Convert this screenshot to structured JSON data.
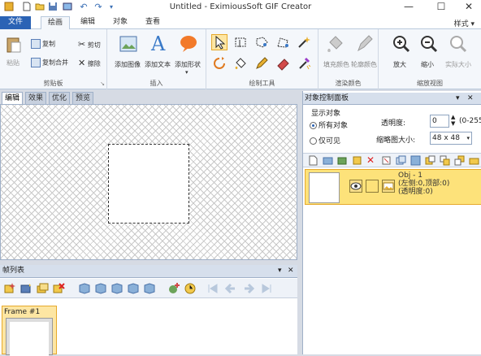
{
  "window": {
    "title": "Untitled - EximiousSoft GIF Creator",
    "style_menu": "样式 ▾"
  },
  "tabs": [
    {
      "label": "文件"
    },
    {
      "label": "绘画"
    },
    {
      "label": "编辑"
    },
    {
      "label": "对象"
    },
    {
      "label": "查看"
    }
  ],
  "ribbon": {
    "clipboard": {
      "name": "剪贴板",
      "paste": "粘贴",
      "copy": "复制",
      "cut": "剪切",
      "copy_merge": "复制合并",
      "erase": "擦除"
    },
    "insert": {
      "name": "插入",
      "add_image": "添加图像",
      "add_text": "添加文本",
      "add_shape": "添加形状"
    },
    "draw_tools": {
      "name": "绘制工具"
    },
    "fill_color": {
      "name": "渲染颜色",
      "fill": "填充颜色",
      "outline": "轮廓颜色"
    },
    "zoom": {
      "name": "缩放视图",
      "zoom_in": "放大",
      "zoom_out": "缩小",
      "actual_size": "实际大小"
    }
  },
  "doc_tabs": [
    {
      "label": "编辑"
    },
    {
      "label": "效果"
    },
    {
      "label": "优化"
    },
    {
      "label": "预览"
    }
  ],
  "frame_panel": {
    "title": "帧列表",
    "frames": [
      {
        "label": "Frame #1"
      }
    ]
  },
  "object_panel": {
    "title": "对象控制面板",
    "display_label": "显示对象",
    "all_objects": "所有对象",
    "visible_only": "仅可见",
    "opacity_label": "透明度:",
    "opacity_value": "0",
    "opacity_range": "(0-255",
    "thumb_size_label": "缩略图大小:",
    "thumb_size_value": "48 x 48",
    "object": {
      "name": "Obj - 1",
      "position": "(左侧:0,顶部:0)",
      "opacity": "(透明度:0)"
    }
  },
  "colors": {
    "accent": "#2b63b5",
    "selection": "#fde27a",
    "selection_border": "#e6a92c"
  }
}
